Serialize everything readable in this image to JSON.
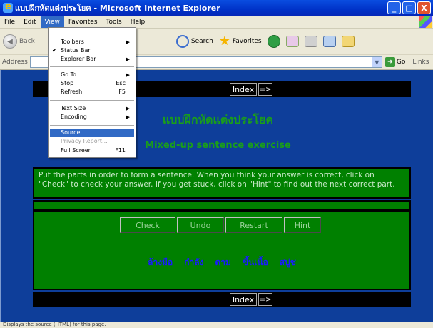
{
  "window": {
    "title": "แบบฝึกหัดแต่งประโยค - Microsoft Internet Explorer",
    "min_symbol": "_",
    "max_symbol": "□",
    "close_symbol": "X"
  },
  "menubar": {
    "items": [
      "File",
      "Edit",
      "View",
      "Favorites",
      "Tools",
      "Help"
    ],
    "active": "View"
  },
  "toolbar": {
    "back_label": "Back",
    "search_label": "Search",
    "favorites_label": "Favorites"
  },
  "addressbar": {
    "label": "Address",
    "value": "",
    "go_label": "Go",
    "links_label": "Links"
  },
  "view_menu": {
    "items": [
      {
        "label": "Toolbars",
        "submenu": true
      },
      {
        "label": "Status Bar",
        "checked": true
      },
      {
        "label": "Explorer Bar",
        "submenu": true
      },
      {
        "label": "Go To",
        "submenu": true
      },
      {
        "label": "Stop",
        "shortcut": "Esc"
      },
      {
        "label": "Refresh",
        "shortcut": "F5"
      },
      {
        "label": "Text Size",
        "submenu": true
      },
      {
        "label": "Encoding",
        "submenu": true
      },
      {
        "label": "Source",
        "selected": true
      },
      {
        "label": "Privacy Report...",
        "disabled": true
      },
      {
        "label": "Full Screen",
        "shortcut": "F11"
      }
    ]
  },
  "page": {
    "nav_index": "Index",
    "nav_next": "=>",
    "thai_title": "แบบฝึกหัดแต่งประโยค",
    "english_title": "Mixed-up sentence exercise",
    "instructions": "Put the parts in order to form a sentence. When you think your answer is correct, click on \"Check\" to check your answer. If you get stuck, click on \"Hint\" to find out the next correct part.",
    "buttons": [
      "Check",
      "Undo",
      "Restart",
      "Hint"
    ],
    "words": [
      "ล้างมือ",
      "กำลัง",
      "ตาม",
      "ขึ้นเนื้อ",
      "สบู่ช"
    ]
  },
  "statusbar": {
    "text": "Displays the source (HTML) for this page."
  },
  "colors": {
    "page_bg": "#0e3e9a",
    "panel_green": "#008000",
    "title_green": "#1a9e1a",
    "word_blue": "#1a1aff",
    "menu_highlight": "#316ac5"
  }
}
